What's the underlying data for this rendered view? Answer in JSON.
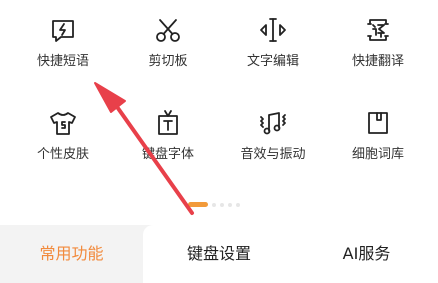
{
  "features": [
    {
      "label": "快捷短语",
      "icon": "quick-phrase-icon"
    },
    {
      "label": "剪切板",
      "icon": "scissors-icon"
    },
    {
      "label": "文字编辑",
      "icon": "text-edit-icon"
    },
    {
      "label": "快捷翻译",
      "icon": "translate-icon"
    },
    {
      "label": "个性皮肤",
      "icon": "tshirt-icon"
    },
    {
      "label": "键盘字体",
      "icon": "font-icon"
    },
    {
      "label": "音效与振动",
      "icon": "music-vibration-icon"
    },
    {
      "label": "细胞词库",
      "icon": "dictionary-icon"
    }
  ],
  "pager": {
    "total": 5,
    "current": 1
  },
  "tabs": [
    {
      "label": "常用功能",
      "active": true
    },
    {
      "label": "键盘设置",
      "active": false
    },
    {
      "label": "AI服务",
      "active": false
    }
  ],
  "colors": {
    "accent": "#f28a3c",
    "arrow": "#e8404a",
    "icon_stroke": "#222222"
  }
}
